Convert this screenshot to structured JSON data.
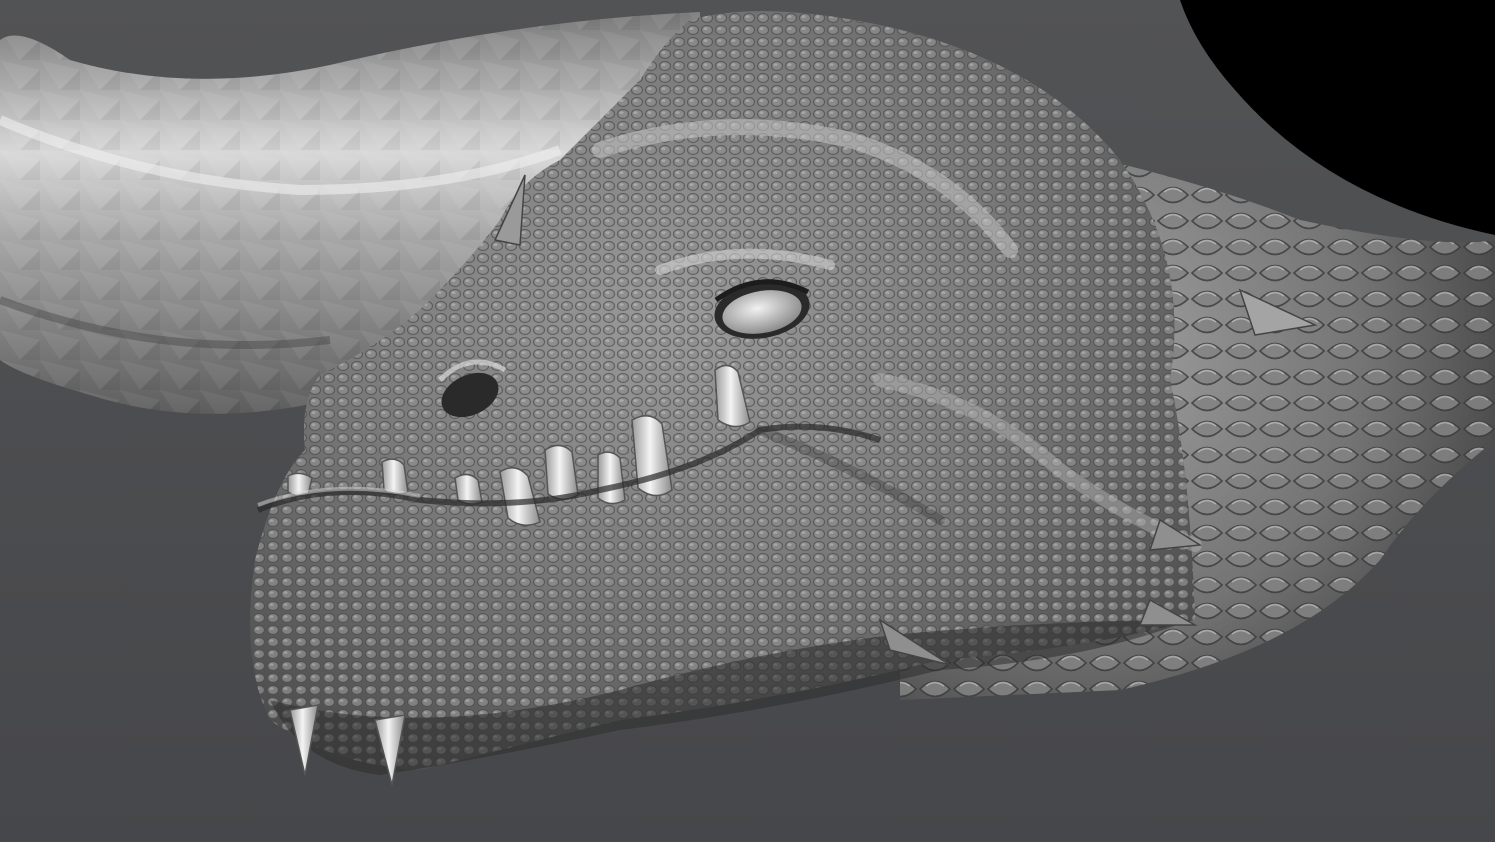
{
  "viewport": {
    "background_color": "#4a4b4d",
    "void_color": "#000000",
    "material_base_color": "#8a8a8a",
    "material_highlight_color": "#e8e8e8",
    "material_shadow_color": "#2c2c2c"
  },
  "subject": {
    "name": "dragon-head-sculpt"
  }
}
